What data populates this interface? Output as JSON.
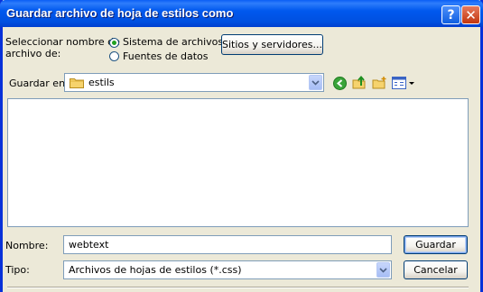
{
  "dialog": {
    "title": "Guardar archivo de hoja de estilos como",
    "help_glyph": "?",
    "close_glyph": "✕"
  },
  "source": {
    "label_line1": "Seleccionar nombre de",
    "label_line2": "archivo de:",
    "options": [
      {
        "label": "Sistema de archivos",
        "selected": true
      },
      {
        "label": "Fuentes de datos",
        "selected": false
      }
    ],
    "sites_button": "Sitios y servidores..."
  },
  "location": {
    "label": "Guardar en:",
    "current_folder": "estils",
    "toolbar_icons": [
      "back-icon",
      "up-folder-icon",
      "new-folder-icon",
      "view-menu-icon"
    ]
  },
  "filename": {
    "label": "Nombre:",
    "value": "webtext"
  },
  "filetype": {
    "label": "Tipo:",
    "value": "Archivos de hojas de estilos (*.css)"
  },
  "actions": {
    "save": "Guardar",
    "cancel": "Cancelar"
  },
  "colors": {
    "titlebar": "#0058ee",
    "dialog_bg": "#ece9d8",
    "field_border": "#7f9db9",
    "radio_dot": "#21a121"
  }
}
